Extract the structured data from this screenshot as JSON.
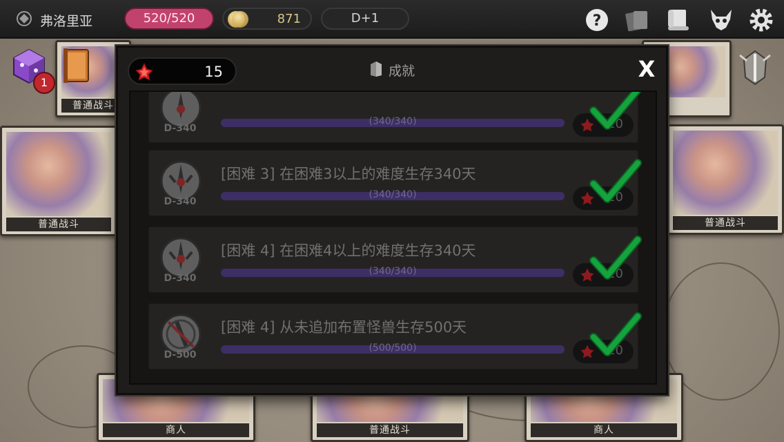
{
  "topbar": {
    "location": "弗洛里亚",
    "hp": "520/520",
    "gold": "871",
    "day": "D+1",
    "icons": [
      "map-marker-icon",
      "help-icon",
      "cards-icon",
      "scroll-icon",
      "demon-icon",
      "settings-icon"
    ]
  },
  "side": {
    "cube_badge": "1",
    "icons": [
      "cube-icon",
      "book-icon",
      "trophy-icon"
    ]
  },
  "background_cards": {
    "labels": [
      "普通战斗",
      "普通战斗",
      "普通战斗",
      "商人",
      "普通战斗",
      "商人"
    ]
  },
  "modal": {
    "gem_count": "15",
    "title": "成就",
    "close_label": "X",
    "achievements": [
      {
        "badge": "D-340",
        "title": "",
        "progress_text": "(340/340)",
        "progress": 1.0,
        "reward": "20",
        "completed": true
      },
      {
        "badge": "D-340",
        "title": "[困难 3] 在困难3以上的难度生存340天",
        "progress_text": "(340/340)",
        "progress": 1.0,
        "reward": "20",
        "completed": true
      },
      {
        "badge": "D-340",
        "title": "[困难 4] 在困难4以上的难度生存340天",
        "progress_text": "(340/340)",
        "progress": 1.0,
        "reward": "20",
        "completed": true
      },
      {
        "badge": "D-500",
        "title": "[困难 4] 从未追加布置怪兽生存500天",
        "progress_text": "(500/500)",
        "progress": 1.0,
        "reward": "20",
        "completed": true
      }
    ]
  },
  "colors": {
    "hp_pill": "#c2426e",
    "progress_bar": "#3b2e5e",
    "check": "#14a33c",
    "gem": "#d4202a"
  }
}
